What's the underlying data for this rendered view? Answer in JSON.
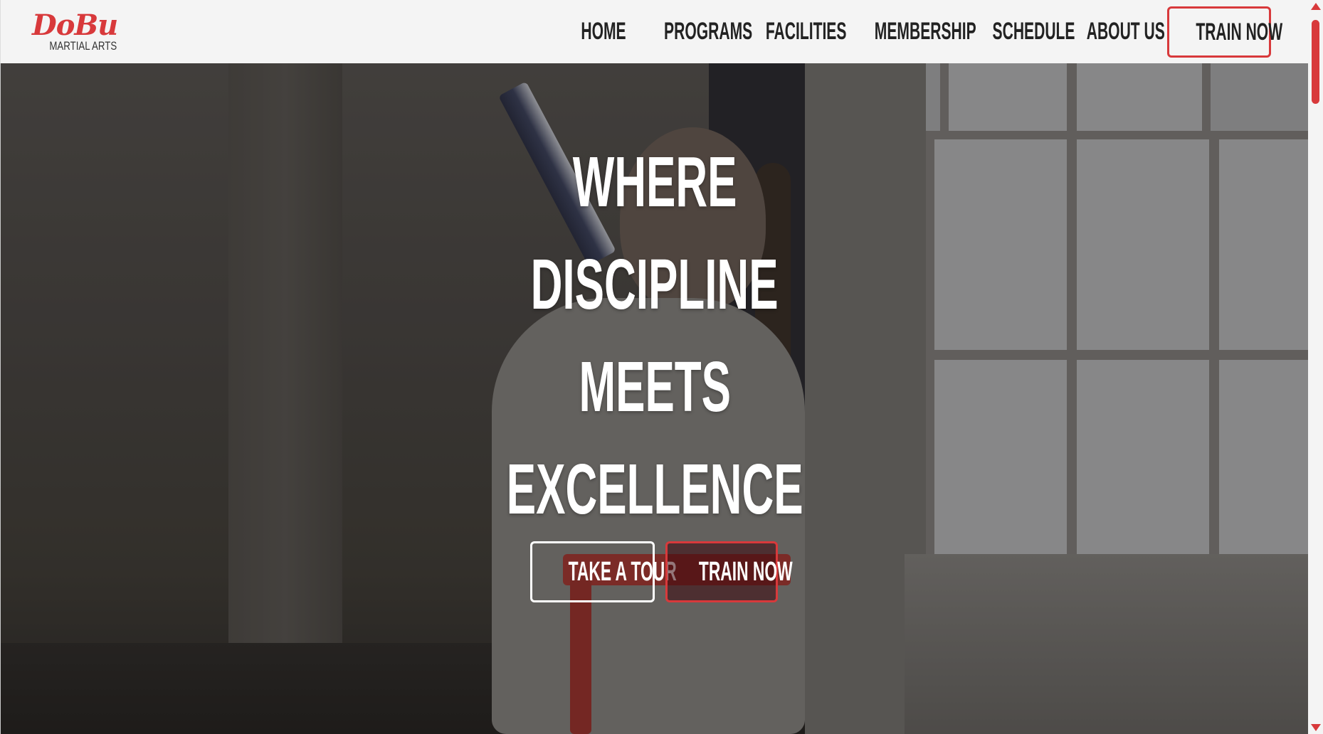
{
  "brand": {
    "logo_main": "DoBu",
    "logo_sub": "MARTIAL ARTS",
    "accent_color": "#d8393b"
  },
  "nav": {
    "items": [
      "HOME",
      "PROGRAMS",
      "FACILITIES",
      "MEMBERSHIP",
      "SCHEDULE",
      "ABOUT US"
    ],
    "cta_label": "TRAIN NOW"
  },
  "hero": {
    "headline_lines": [
      "WHERE",
      "DISCIPLINE",
      "MEETS",
      "EXCELLENCE"
    ],
    "tour_button_label": "TAKE A TOUR",
    "train_button_label": "TRAIN NOW"
  }
}
